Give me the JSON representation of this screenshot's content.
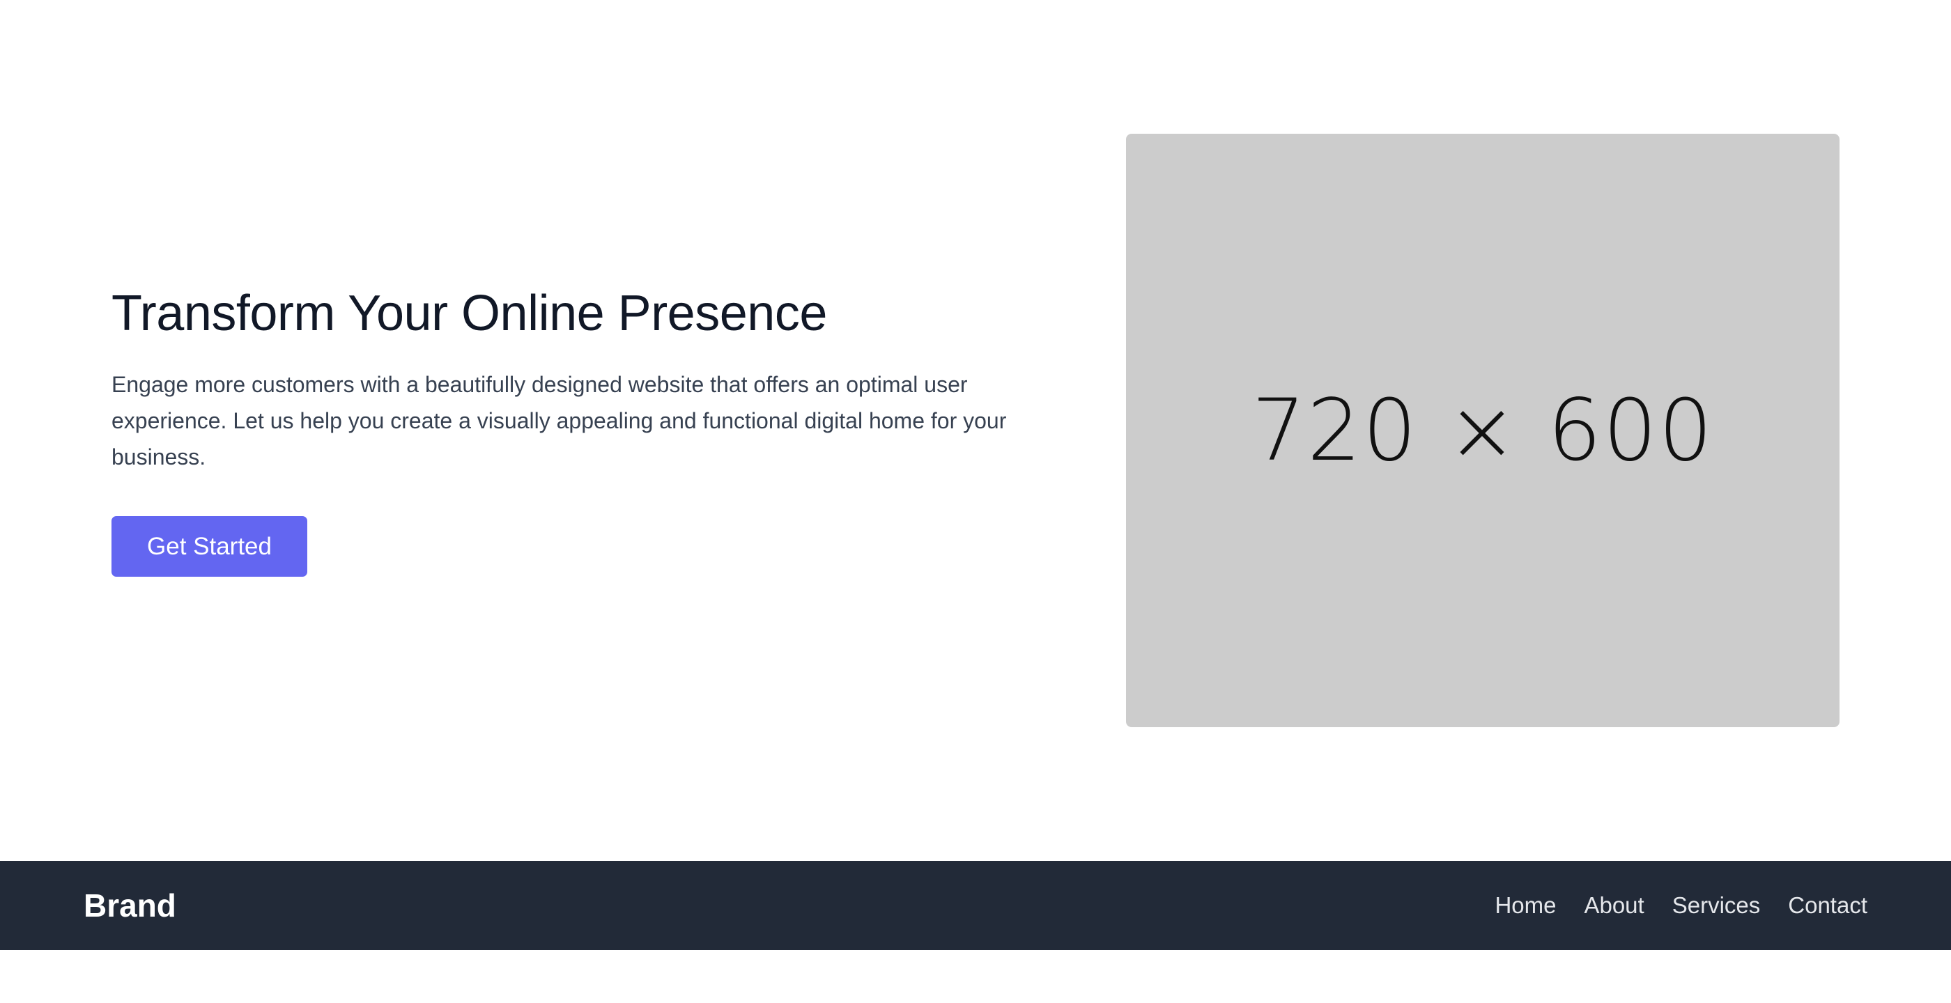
{
  "hero": {
    "title": "Transform Your Online Presence",
    "description": "Engage more customers with a beautifully designed website that offers an optimal user experience. Let us help you create a visually appealing and functional digital home for your business.",
    "cta_label": "Get Started",
    "image_placeholder_label": "720 × 600"
  },
  "navbar": {
    "brand": "Brand",
    "links": [
      {
        "label": "Home"
      },
      {
        "label": "About"
      },
      {
        "label": "Services"
      },
      {
        "label": "Contact"
      }
    ]
  },
  "colors": {
    "accent": "#6366f1",
    "navbar_bg": "#222a38",
    "placeholder_bg": "#cccccc",
    "heading": "#111827",
    "body_text": "#374151"
  }
}
